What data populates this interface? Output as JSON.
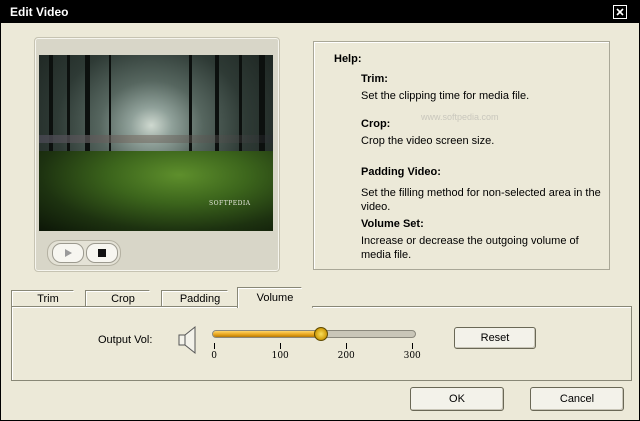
{
  "window": {
    "title": "Edit Video"
  },
  "video": {
    "logo_text": "SOFTPEDIA"
  },
  "help": {
    "heading": "Help:",
    "items": [
      {
        "title": "Trim:",
        "desc": "Set the clipping time for media file."
      },
      {
        "title": "Crop:",
        "desc": "Crop the video screen size."
      },
      {
        "title": "Padding Video:",
        "desc": "Set the filling method for non-selected area in the video."
      },
      {
        "title": "Volume Set:",
        "desc": "Increase or decrease the outgoing volume of media file."
      }
    ],
    "watermark": "www.softpedia.com"
  },
  "tabs": [
    {
      "label": "Trim"
    },
    {
      "label": "Crop"
    },
    {
      "label": "Padding"
    },
    {
      "label": "Volume",
      "active": true
    }
  ],
  "volume": {
    "label": "Output Vol:",
    "value": 160,
    "max": 300,
    "ticks": [
      "0",
      "100",
      "200",
      "300"
    ],
    "reset_label": "Reset"
  },
  "buttons": {
    "ok": "OK",
    "cancel": "Cancel"
  },
  "colors": {
    "titlebar": "#000000",
    "dialog": "#ece9d8",
    "slider_fill": "#e6a31a"
  }
}
